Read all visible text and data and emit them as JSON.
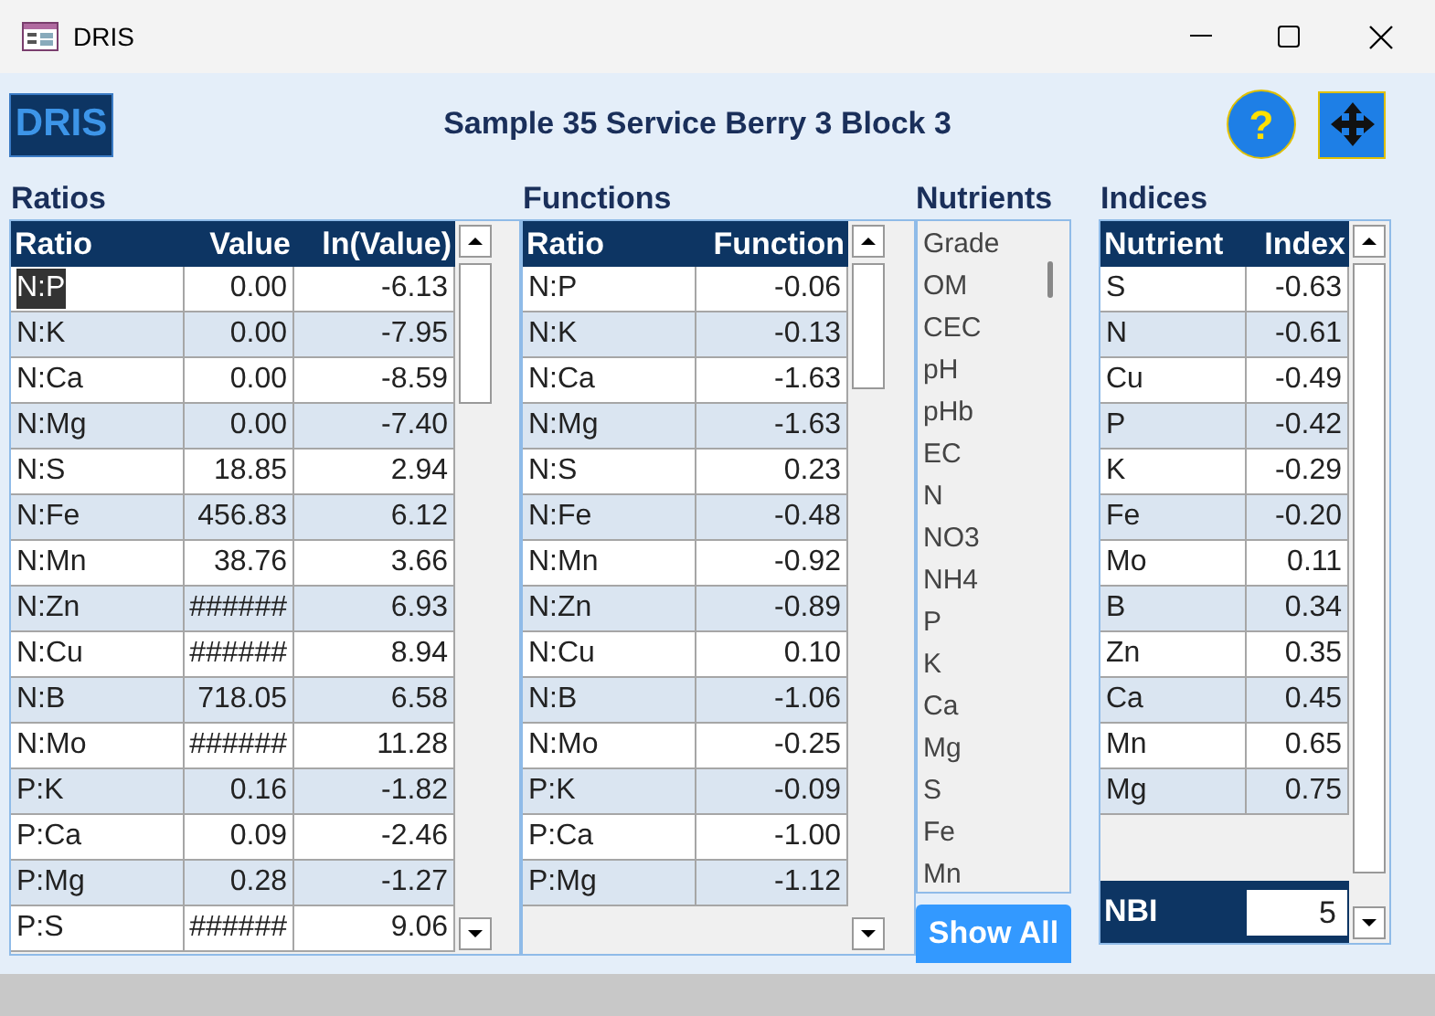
{
  "window": {
    "title": "DRIS"
  },
  "header": {
    "logo": "DRIS",
    "title": "Sample 35 Service Berry 3 Block 3",
    "help": "?"
  },
  "ratios": {
    "title": "Ratios",
    "columns": [
      "Ratio",
      "Value",
      "ln(Value)"
    ],
    "rows": [
      {
        "cells": [
          "N:P",
          "0.00",
          "-6.13"
        ],
        "selected": true
      },
      {
        "cells": [
          "N:K",
          "0.00",
          "-7.95"
        ],
        "selected": false
      },
      {
        "cells": [
          "N:Ca",
          "0.00",
          "-8.59"
        ],
        "selected": false
      },
      {
        "cells": [
          "N:Mg",
          "0.00",
          "-7.40"
        ],
        "selected": false
      },
      {
        "cells": [
          "N:S",
          "18.85",
          "2.94"
        ],
        "selected": false
      },
      {
        "cells": [
          "N:Fe",
          "456.83",
          "6.12"
        ],
        "selected": false
      },
      {
        "cells": [
          "N:Mn",
          "38.76",
          "3.66"
        ],
        "selected": false
      },
      {
        "cells": [
          "N:Zn",
          "######",
          "6.93"
        ],
        "selected": false
      },
      {
        "cells": [
          "N:Cu",
          "######",
          "8.94"
        ],
        "selected": false
      },
      {
        "cells": [
          "N:B",
          "718.05",
          "6.58"
        ],
        "selected": false
      },
      {
        "cells": [
          "N:Mo",
          "######",
          "11.28"
        ],
        "selected": false
      },
      {
        "cells": [
          "P:K",
          "0.16",
          "-1.82"
        ],
        "selected": false
      },
      {
        "cells": [
          "P:Ca",
          "0.09",
          "-2.46"
        ],
        "selected": false
      },
      {
        "cells": [
          "P:Mg",
          "0.28",
          "-1.27"
        ],
        "selected": false
      },
      {
        "cells": [
          "P:S",
          "######",
          "9.06"
        ],
        "selected": false
      }
    ]
  },
  "functions": {
    "title": "Functions",
    "columns": [
      "Ratio",
      "Function"
    ],
    "rows": [
      {
        "cells": [
          "N:P",
          "-0.06"
        ]
      },
      {
        "cells": [
          "N:K",
          "-0.13"
        ]
      },
      {
        "cells": [
          "N:Ca",
          "-1.63"
        ]
      },
      {
        "cells": [
          "N:Mg",
          "-1.63"
        ]
      },
      {
        "cells": [
          "N:S",
          "0.23"
        ]
      },
      {
        "cells": [
          "N:Fe",
          "-0.48"
        ]
      },
      {
        "cells": [
          "N:Mn",
          "-0.92"
        ]
      },
      {
        "cells": [
          "N:Zn",
          "-0.89"
        ]
      },
      {
        "cells": [
          "N:Cu",
          "0.10"
        ]
      },
      {
        "cells": [
          "N:B",
          "-1.06"
        ]
      },
      {
        "cells": [
          "N:Mo",
          "-0.25"
        ]
      },
      {
        "cells": [
          "P:K",
          "-0.09"
        ]
      },
      {
        "cells": [
          "P:Ca",
          "-1.00"
        ]
      },
      {
        "cells": [
          "P:Mg",
          "-1.12"
        ]
      }
    ]
  },
  "nutrients": {
    "title": "Nutrients",
    "items": [
      "Grade",
      "OM",
      "CEC",
      "pH",
      "pHb",
      "EC",
      "N",
      "NO3",
      "NH4",
      "P",
      "K",
      "Ca",
      "Mg",
      "S",
      "Fe",
      "Mn"
    ],
    "button": "Show All"
  },
  "indices": {
    "title": "Indices",
    "columns": [
      "Nutrient",
      "Index"
    ],
    "rows": [
      {
        "cells": [
          "S",
          "-0.63"
        ]
      },
      {
        "cells": [
          "N",
          "-0.61"
        ]
      },
      {
        "cells": [
          "Cu",
          "-0.49"
        ]
      },
      {
        "cells": [
          "P",
          "-0.42"
        ]
      },
      {
        "cells": [
          "K",
          "-0.29"
        ]
      },
      {
        "cells": [
          "Fe",
          "-0.20"
        ]
      },
      {
        "cells": [
          "Mo",
          "0.11"
        ]
      },
      {
        "cells": [
          "B",
          "0.34"
        ]
      },
      {
        "cells": [
          "Zn",
          "0.35"
        ]
      },
      {
        "cells": [
          "Ca",
          "0.45"
        ]
      },
      {
        "cells": [
          "Mn",
          "0.65"
        ]
      },
      {
        "cells": [
          "Mg",
          "0.75"
        ]
      }
    ],
    "footer_label": "NBI",
    "footer_value": "5"
  }
}
